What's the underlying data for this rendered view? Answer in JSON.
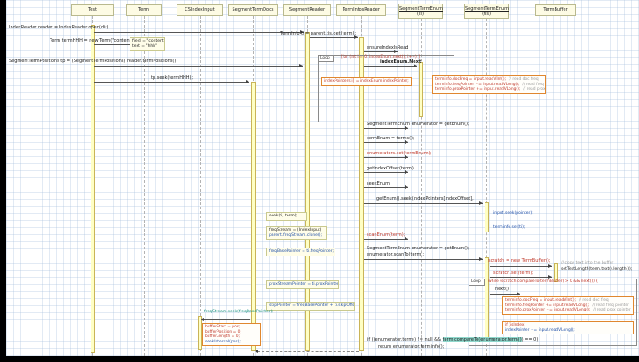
{
  "actors": {
    "test": {
      "name": "Test"
    },
    "term": {
      "name": "Term"
    },
    "cs_index_input": {
      "name": "CSIndexInput"
    },
    "segment_term_docs": {
      "name": "SegmentTermDocs"
    },
    "segment_reader": {
      "name": "SegmentReader"
    },
    "term_infos_reader": {
      "name": "TermInfosReader"
    },
    "segment_term_enum_is": {
      "name": "SegmentTermEnum",
      "instance": "(is)"
    },
    "segment_term_enum_tis": {
      "name": "SegmentTermEnum",
      "instance": "(tis)"
    },
    "term_buffer": {
      "name": "TermBuffer"
    }
  },
  "messages": {
    "open_reader": "IndexReader reader = IndexReader.open(dir)",
    "new_term": "Term termHHH = new Term(\"content\", \"hhh\")",
    "term_positions": "SegmentTermPositions tp = (SegmentTermPositions) reader.termPositions()",
    "tp_seek": "tp.seek(termHHH);",
    "tis_get": "TermInfo ti = parent.tis.get(term);",
    "ensure_index_is_read": "ensureIndexIsRead",
    "index_enum_next": "indexEnum.Next",
    "get_enum": "SegmentTermEnum enumerator = getEnum();",
    "terms": "termEnum = terms();",
    "enumerators_set": "enumerators.set(termEnum);",
    "get_index_offset": "getIndexOffset(term);",
    "seek_enum": "seekEnum",
    "get_enum_seek": "getEnum().seek(indexPointers[indexOffset],",
    "scan_enum": "scanEnum(term);",
    "scan_get_enum": "SegmentTermEnum enumerator = getEnum();",
    "scan_to": "enumerator.scanTo(term);",
    "new_term_buffer": "scratch = new TermBuffer();",
    "scratch_set": "scratch.set(term);",
    "next": "next()",
    "return_check_pre": "if ((enumerator.term() != null && ",
    "return_check_hl": "term.compareTo(enumerator.term()",
    "return_check_post": ") == 0)",
    "return_stmt": "return enumerator.terminfo();"
  },
  "loops": {
    "index_loop": {
      "tab": "Loop",
      "condition": "[for (int i = 0; indexEnum.next(); i++) ]"
    },
    "scan_loop": {
      "tab": "Loop",
      "condition": "while (scratch.compareTo(termBuffer) > 0 && next()) {"
    }
  },
  "notes": {
    "term_fields_line1": "field = \"content\"",
    "term_fields_line2": "text = \"hhh\"",
    "index_pointers": "indexPointers[i] = indexEnum.indexPointer;",
    "input_seek": "input.seek(pointer);",
    "terminfo_set": "terminfo.set(ti);",
    "buffer_copy_comment": "// copy text into the buffer",
    "buffer_copy_code": "setTextLength(term.text().length());",
    "seek_ti": "seek(ti, term);",
    "freq_stream_line1": "freqStream = (IndexInput)",
    "freq_stream_line2": "parent.freqStream.clone();",
    "freq_base_pointer": "freqBasePointer = ti.freqPointer;",
    "prox_stream_pointer": "proxStreamPointer = ti.proxPointer;",
    "skip_pointer": "skipPointer = freqBasePointer + ti.skipOffset;",
    "freq_stream_seek": "freqStream.seek(freqBasePointer);",
    "if_is_index": "if (isIndex)",
    "index_pointer_read": "indexPointer += input.readVLong();"
  },
  "code_boxes": {
    "read_terminfo": {
      "rows": [
        {
          "code": "terminfo.docFreq = input.readVInt();",
          "comment": "// read doc freq"
        },
        {
          "code": "terminfo.freqPointer += input.readVLong();",
          "comment": "// read freq pointer"
        },
        {
          "code": "terminfo.proxPointer += input.readVLong();",
          "comment": "// read prox pointer"
        }
      ]
    },
    "buffer_seek": {
      "rows": [
        {
          "code": "bufferStart = pos;"
        },
        {
          "code": "bufferPosition = 0;"
        },
        {
          "code": "bufferLength = 0;"
        },
        {
          "code": "seekInternal(pos);"
        }
      ]
    }
  }
}
